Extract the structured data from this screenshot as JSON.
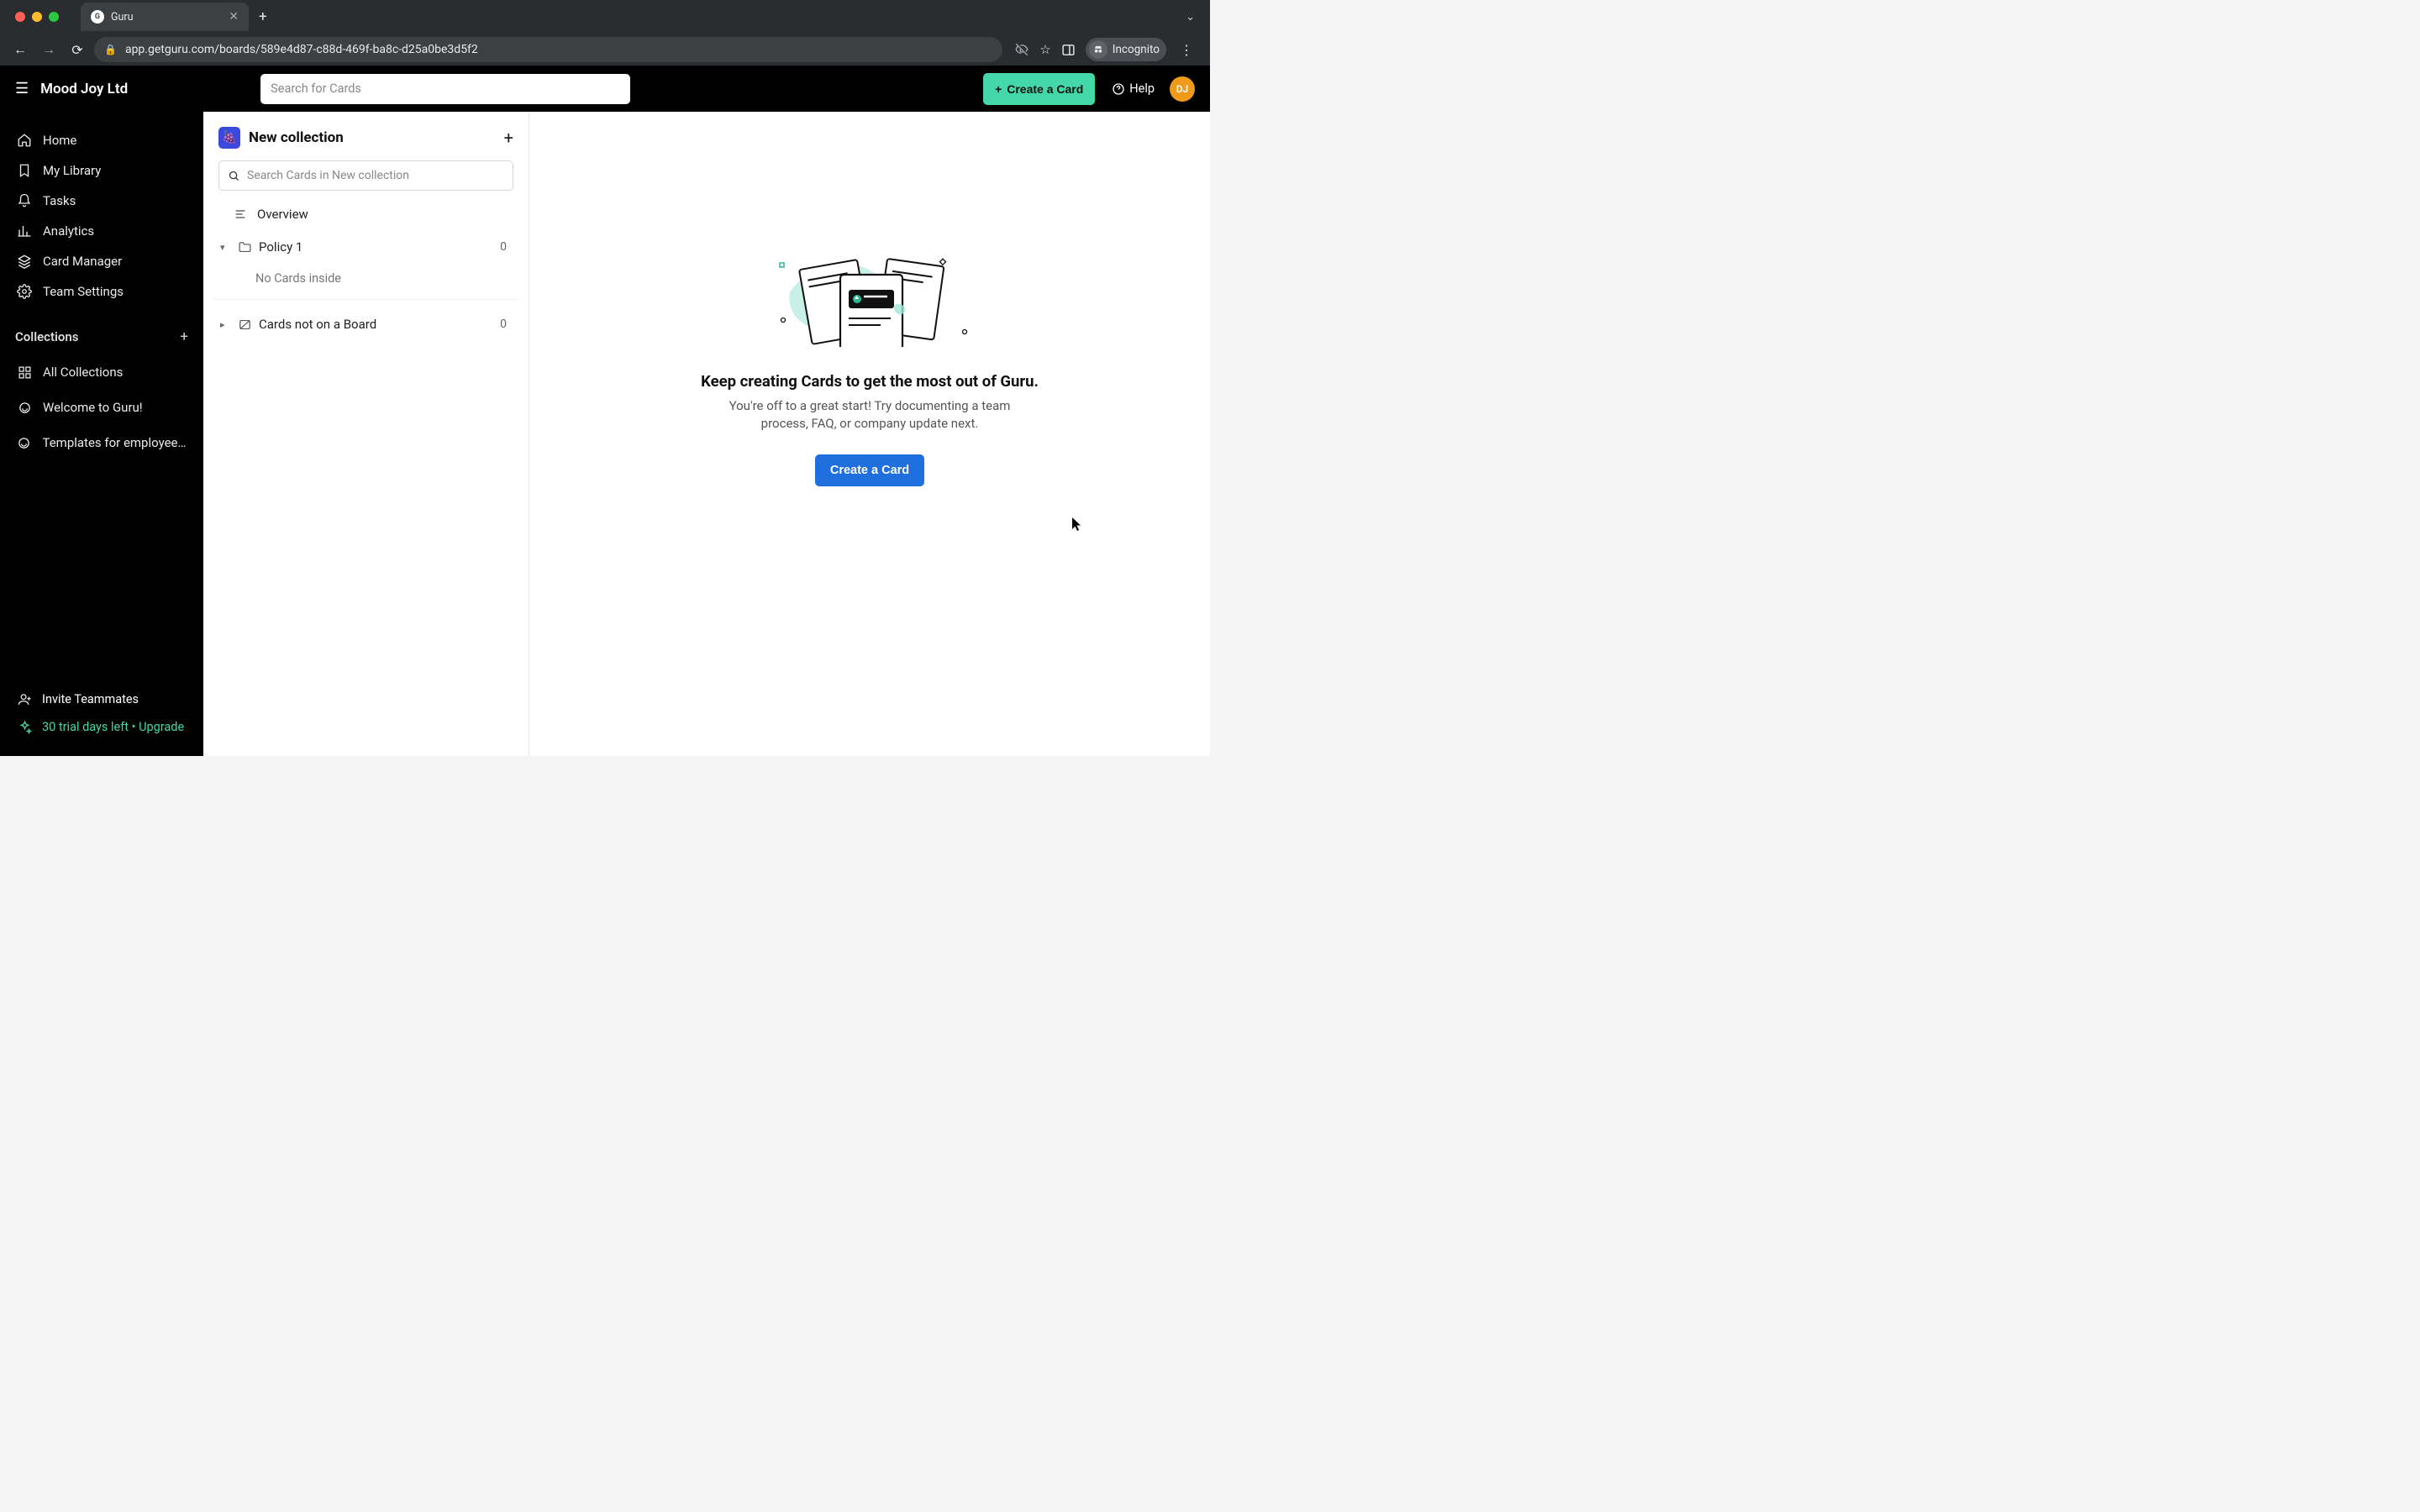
{
  "browser": {
    "tab_title": "Guru",
    "url": "app.getguru.com/boards/589e4d87-c88d-469f-ba8c-d25a0be3d5f2",
    "incognito_label": "Incognito"
  },
  "header": {
    "brand": "Mood Joy Ltd",
    "search_placeholder": "Search for Cards",
    "create_card": "Create a Card",
    "help": "Help",
    "avatar_initials": "DJ"
  },
  "sidebar": {
    "items": [
      {
        "label": "Home"
      },
      {
        "label": "My Library"
      },
      {
        "label": "Tasks"
      },
      {
        "label": "Analytics"
      },
      {
        "label": "Card Manager"
      },
      {
        "label": "Team Settings"
      }
    ],
    "collections_heading": "Collections",
    "collections": [
      {
        "label": "All Collections"
      },
      {
        "label": "Welcome to Guru!"
      },
      {
        "label": "Templates for employee ..."
      }
    ],
    "invite": "Invite Teammates",
    "upgrade": "30 trial days left • Upgrade"
  },
  "collection_panel": {
    "title": "New collection",
    "search_placeholder": "Search Cards in New collection",
    "overview": "Overview",
    "folder": {
      "name": "Policy 1",
      "count": "0",
      "empty": "No Cards inside"
    },
    "loose": {
      "name": "Cards not on a Board",
      "count": "0"
    }
  },
  "main": {
    "title": "Keep creating Cards to get the most out of Guru.",
    "subtitle": "You're off to a great start! Try documenting a team process, FAQ, or company update next.",
    "cta": "Create a Card"
  }
}
